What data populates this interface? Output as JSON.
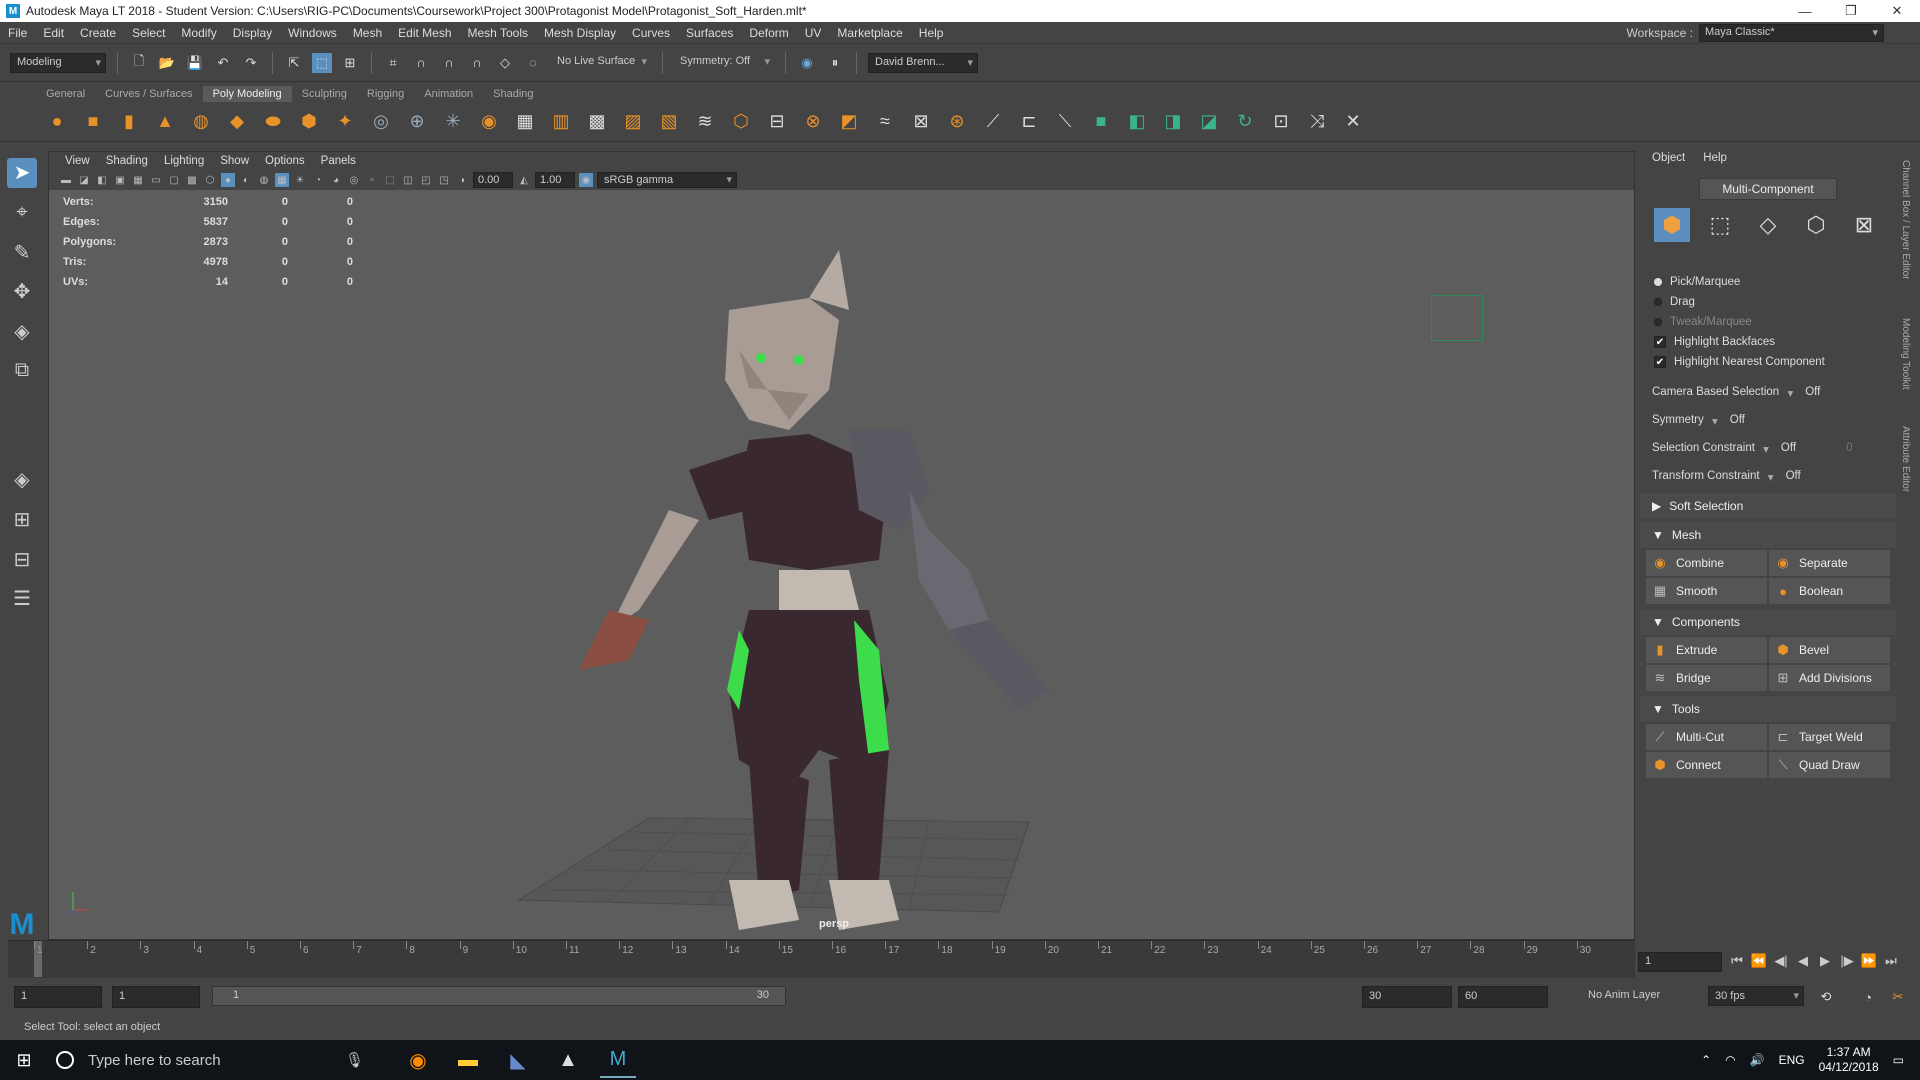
{
  "title": "Autodesk Maya LT 2018 - Student Version: C:\\Users\\RIG-PC\\Documents\\Coursework\\Project 300\\Protagonist Model\\Protagonist_Soft_Harden.mlt*",
  "menu": [
    "File",
    "Edit",
    "Create",
    "Select",
    "Modify",
    "Display",
    "Windows",
    "Mesh",
    "Edit Mesh",
    "Mesh Tools",
    "Mesh Display",
    "Curves",
    "Surfaces",
    "Deform",
    "UV",
    "Marketplace",
    "Help"
  ],
  "workspace_label": "Workspace :",
  "workspace_value": "Maya Classic*",
  "mode": "Modeling",
  "live_surface": "No Live Surface",
  "symmetry": "Symmetry: Off",
  "user": "David Brenn...",
  "shelf_tabs": [
    "General",
    "Curves / Surfaces",
    "Poly Modeling",
    "Sculpting",
    "Rigging",
    "Animation",
    "Shading"
  ],
  "vp_menu": [
    "View",
    "Shading",
    "Lighting",
    "Show",
    "Options",
    "Panels"
  ],
  "vp_num1": "0.00",
  "vp_num2": "1.00",
  "vp_gamma": "sRGB gamma",
  "hud": [
    {
      "label": "Verts:",
      "a": "3150",
      "b": "0",
      "c": "0"
    },
    {
      "label": "Edges:",
      "a": "5837",
      "b": "0",
      "c": "0"
    },
    {
      "label": "Polygons:",
      "a": "2873",
      "b": "0",
      "c": "0"
    },
    {
      "label": "Tris:",
      "a": "4978",
      "b": "0",
      "c": "0"
    },
    {
      "label": "UVs:",
      "a": "14",
      "b": "0",
      "c": "0"
    }
  ],
  "camera": "persp",
  "right": {
    "menu": [
      "Object",
      "Help"
    ],
    "mc": "Multi-Component",
    "radios": [
      "Pick/Marquee",
      "Drag",
      "Tweak/Marquee"
    ],
    "checks": [
      "Highlight Backfaces",
      "Highlight Nearest Component"
    ],
    "opts": [
      {
        "label": "Camera Based Selection",
        "val": "Off"
      },
      {
        "label": "Symmetry",
        "val": "Off"
      },
      {
        "label": "Selection Constraint",
        "val": "Off",
        "extra": "0"
      },
      {
        "label": "Transform Constraint",
        "val": "Off"
      }
    ],
    "soft": "Soft Selection",
    "mesh": "Mesh",
    "mesh_btns": [
      "Combine",
      "Separate",
      "Smooth",
      "Boolean"
    ],
    "components": "Components",
    "comp_btns": [
      "Extrude",
      "Bevel",
      "Bridge",
      "Add Divisions"
    ],
    "tools": "Tools",
    "tool_btns": [
      "Multi-Cut",
      "Target Weld",
      "Connect",
      "Quad Draw"
    ]
  },
  "vtabs": [
    "Channel Box / Layer Editor",
    "Modeling Toolkit",
    "Attribute Editor"
  ],
  "timeline_ticks": [
    "1",
    "2",
    "3",
    "4",
    "5",
    "6",
    "7",
    "8",
    "9",
    "10",
    "11",
    "12",
    "13",
    "14",
    "15",
    "16",
    "17",
    "18",
    "19",
    "20",
    "21",
    "22",
    "23",
    "24",
    "25",
    "26",
    "27",
    "28",
    "29",
    "30"
  ],
  "current_frame": "1",
  "range": {
    "start": "1",
    "inner_start": "1",
    "slider_start": "1",
    "slider_end": "30",
    "end": "30",
    "anim_end": "60"
  },
  "anim_layer": "No Anim Layer",
  "fps": "30 fps",
  "help_line": "Select Tool: select an object",
  "taskbar": {
    "search": "Type here to search",
    "lang": "ENG",
    "time": "1:37 AM",
    "date": "04/12/2018"
  }
}
